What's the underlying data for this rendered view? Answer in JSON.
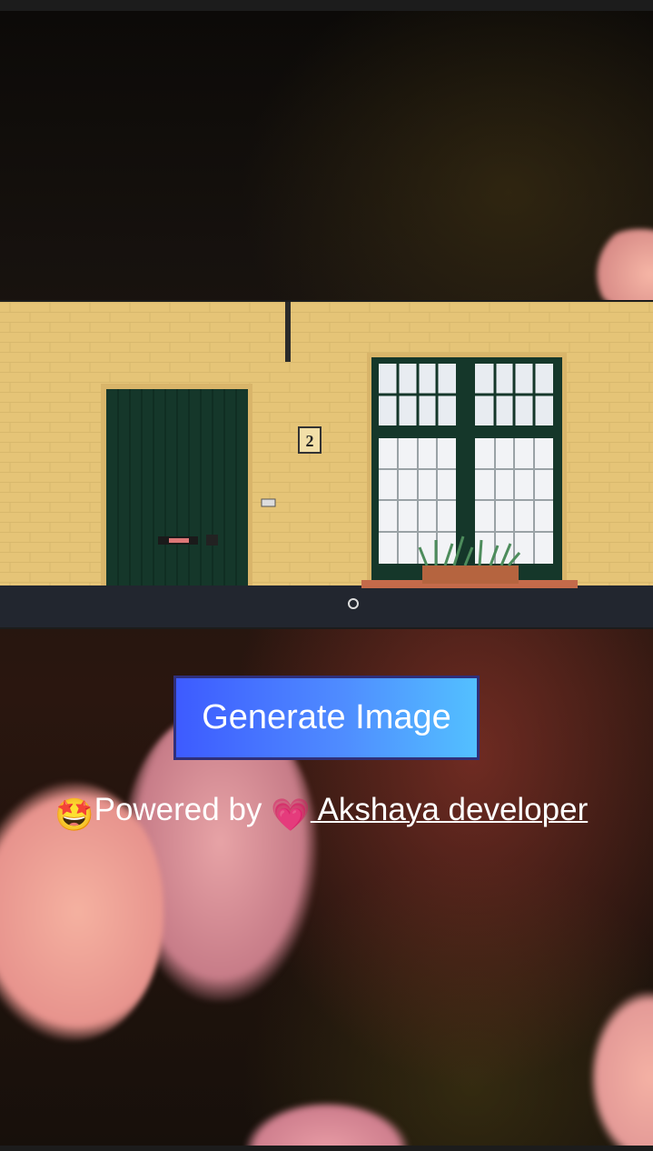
{
  "hero_image": {
    "house_number": "2"
  },
  "actions": {
    "generate_label": "Generate Image"
  },
  "credit": {
    "emoji": "🤩",
    "prefix": "Powered by ",
    "heart": "💗",
    "link_text": " Akshaya developer"
  },
  "colors": {
    "button_start": "#3d5bff",
    "button_end": "#53c0ff",
    "wall": "#e3c173",
    "door": "#15372a",
    "bokeh_pink": "#f0a89a"
  }
}
